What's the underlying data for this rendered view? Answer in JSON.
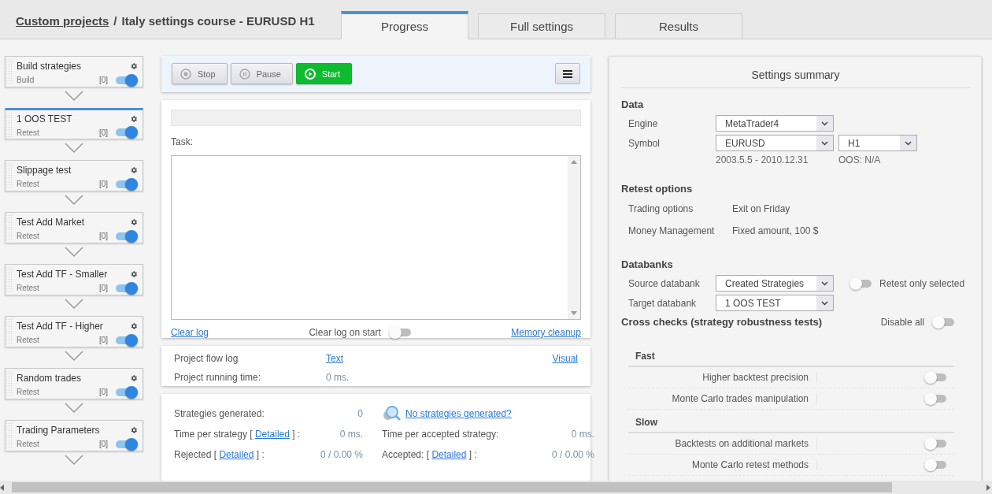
{
  "breadcrumb": {
    "link": "Custom projects",
    "separator": "/",
    "title": "Italy settings course - EURUSD H1"
  },
  "tabs": [
    {
      "label": "Progress",
      "selected": true
    },
    {
      "label": "Full settings",
      "selected": false
    },
    {
      "label": "Results",
      "selected": false
    }
  ],
  "pipeline": [
    {
      "name": "Build strategies",
      "type": "Build",
      "count": "[0]",
      "enabled": true,
      "selected": false
    },
    {
      "name": "1 OOS TEST",
      "type": "Retest",
      "count": "[0]",
      "enabled": true,
      "selected": true
    },
    {
      "name": "Slippage test",
      "type": "Retest",
      "count": "[0]",
      "enabled": true,
      "selected": false
    },
    {
      "name": "Test Add Market",
      "type": "Retest",
      "count": "[0]",
      "enabled": true,
      "selected": false
    },
    {
      "name": "Test Add TF - Smaller",
      "type": "Retest",
      "count": "[0]",
      "enabled": true,
      "selected": false
    },
    {
      "name": "Test Add TF - Higher",
      "type": "Retest",
      "count": "[0]",
      "enabled": true,
      "selected": false
    },
    {
      "name": "Random trades",
      "type": "Retest",
      "count": "[0]",
      "enabled": true,
      "selected": false
    },
    {
      "name": "Trading Parameters",
      "type": "Retest",
      "count": "[0]",
      "enabled": true,
      "selected": false
    }
  ],
  "toolbar": [
    {
      "label": "Stop",
      "kind": "stop"
    },
    {
      "label": "Pause",
      "kind": "pause"
    },
    {
      "label": "Start",
      "kind": "start"
    }
  ],
  "log": {
    "progress": {
      "level": 0
    },
    "task_label": "Task:",
    "clear_log": "Clear log",
    "clear_on_start": {
      "label": "Clear log on start",
      "on": false
    },
    "memory_cleanup": "Memory cleanup"
  },
  "flow": {
    "label": "Project flow log",
    "text_link": "Text",
    "visual_link": "Visual",
    "time_label": "Project running time:",
    "time_value": "0 ms."
  },
  "stats": {
    "left": [
      {
        "label": "Strategies generated:",
        "value": "0"
      },
      {
        "label": "Time per strategy [ ",
        "link": "Detailed",
        "suffix": " ] :",
        "value": "0 ms."
      },
      {
        "label": "Rejected [ ",
        "link": "Detailed",
        "suffix": " ] :",
        "value": "0 / 0.00 %"
      }
    ],
    "help_link": "No strategies generated?",
    "right": [
      {
        "label": "Time per accepted strategy:",
        "value": "0 ms."
      },
      {
        "label": "Accepted: [ ",
        "link": "Detailed",
        "suffix": " ] :",
        "value": "0 / 0.00 %"
      }
    ]
  },
  "summary": {
    "title": "Settings summary",
    "data": {
      "heading": "Data",
      "engine_label": "Engine",
      "engine": "MetaTrader4",
      "symbol_label": "Symbol",
      "symbol": "EURUSD",
      "timeframe": "H1",
      "range": "2003.5.5 - 2010.12.31",
      "oos": "OOS: N/A"
    },
    "retest": {
      "heading": "Retest options",
      "rows": [
        {
          "label": "Trading options",
          "value": "Exit on Friday"
        },
        {
          "label": "Money Management",
          "value": "Fixed amount, 100 $"
        }
      ]
    },
    "databanks": {
      "heading": "Databanks",
      "source_label": "Source databank",
      "source": "Created Strategies",
      "target_label": "Target databank",
      "target": "1 OOS TEST",
      "retest_only": {
        "label": "Retest only selected",
        "on": false
      }
    },
    "cross_checks": {
      "heading": "Cross checks (strategy robustness tests)",
      "disable_all": {
        "label": "Disable all",
        "on": false
      },
      "groups": [
        {
          "name": "Fast",
          "items": [
            {
              "label": "Higher backtest precision",
              "on": false
            },
            {
              "label": "Monte Carlo trades manipulation",
              "on": false
            }
          ]
        },
        {
          "name": "Slow",
          "items": [
            {
              "label": "Backtests on additional markets",
              "on": false
            },
            {
              "label": "Monte Carlo retest methods",
              "on": false
            }
          ]
        }
      ]
    }
  }
}
